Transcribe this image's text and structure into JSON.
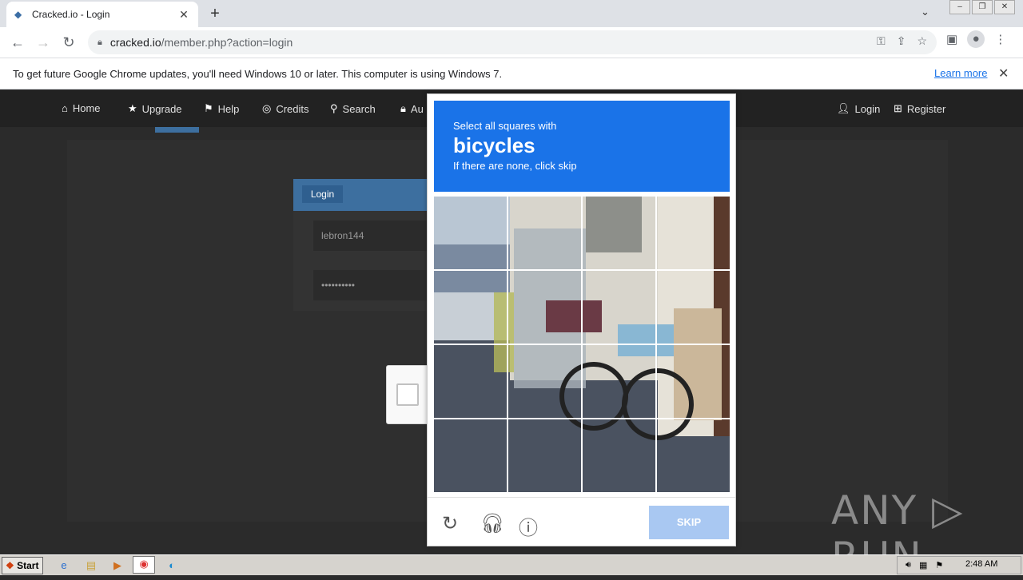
{
  "browser": {
    "tab_title": "Cracked.io - Login",
    "tab_close": "✕",
    "new_tab": "+",
    "url_host": "cracked.io",
    "url_path": "/member.php?action=login",
    "info_text": "To get future Google Chrome updates, you'll need Windows 10 or later. This computer is using Windows 7.",
    "info_link": "Learn more"
  },
  "site": {
    "nav": [
      {
        "icon": "home-icon",
        "label": "Home"
      },
      {
        "icon": "star-icon",
        "label": "Upgrade"
      },
      {
        "icon": "flag-icon",
        "label": "Help"
      },
      {
        "icon": "coins-icon",
        "label": "Credits"
      },
      {
        "icon": "search-icon",
        "label": "Search"
      },
      {
        "icon": "lock-icon",
        "label": "Au"
      }
    ],
    "nav_right": [
      {
        "icon": "user-icon",
        "label": "Login"
      },
      {
        "icon": "plus-icon",
        "label": "Register"
      }
    ],
    "login_title": "Login",
    "username_value": "lebron144",
    "password_value": "••••••••••"
  },
  "captcha": {
    "instruction": "Select all squares with",
    "target": "bicycles",
    "hint": "If there are none, click skip",
    "skip_label": "SKIP",
    "accent_color": "#1a73e8"
  },
  "watermark": "ANY ▷ RUN",
  "taskbar": {
    "start_label": "Start",
    "clock": "2:48 AM"
  }
}
